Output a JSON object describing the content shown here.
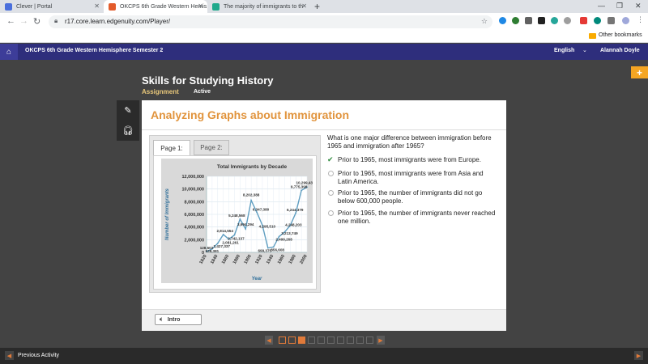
{
  "browser": {
    "tabs": [
      {
        "title": "Clever | Portal",
        "favicon_color": "#4a6fdc"
      },
      {
        "title": "OKCPS 6th Grade Western Hemis",
        "favicon_color": "#e35b2b"
      },
      {
        "title": "The majority of immigrants to th",
        "favicon_color": "#1fa98c"
      }
    ],
    "url": "r17.core.learn.edgenuity.com/Player/",
    "bookmarks_label": "Other bookmarks"
  },
  "app": {
    "course": "OKCPS 6th Grade Western Hemisphere Semester 2",
    "language": "English",
    "user": "Alannah Doyle",
    "accent": "#2e2e7c"
  },
  "lesson": {
    "title": "Skills for Studying History",
    "assignment": "Assignment",
    "status": "Active"
  },
  "card": {
    "title": "Analyzing Graphs about Immigration",
    "tabs": [
      "Page 1:",
      "Page 2:"
    ],
    "question": "What is one major difference between immigration before 1965 and immigration after 1965?",
    "options": [
      {
        "text": "Prior to 1965, most immigrants were from Europe.",
        "selected": true
      },
      {
        "text": "Prior to 1965, most immigrants were from Asia and Latin America.",
        "selected": false
      },
      {
        "text": "Prior to 1965, the number of immigrants did not go below 600,000 people.",
        "selected": false
      },
      {
        "text": "Prior to 1965, the number of immigrants never reached one million.",
        "selected": false
      }
    ],
    "intro_label": "Intro"
  },
  "footer": {
    "prev_label": "Previous Activity"
  },
  "chart_data": {
    "type": "line",
    "title": "Total Immigrants by Decade",
    "xlabel": "Year",
    "ylabel": "Number of Immigrants",
    "x": [
      "1820",
      "1830",
      "1840",
      "1850",
      "1860",
      "1870",
      "1880",
      "1890",
      "1900",
      "1910",
      "1920",
      "1930",
      "1940",
      "1950",
      "1960",
      "1970",
      "1980",
      "1990",
      "2000"
    ],
    "xticks": [
      "1820",
      "1840",
      "1860",
      "1880",
      "1900",
      "1920",
      "1940",
      "1960",
      "1980",
      "2000"
    ],
    "values": [
      128502,
      538381,
      1427337,
      2814554,
      2081261,
      2742137,
      5248568,
      3694294,
      8202388,
      6347380,
      4295510,
      699375,
      856608,
      2499268,
      3213749,
      4248203,
      6244379,
      9775398,
      10299430
    ],
    "labels": [
      "128,502",
      "538,381",
      "1,427,337",
      "2,814,554",
      "2,081,261",
      "2,742,137",
      "5,248,568",
      "3,694,294",
      "8,202,388",
      "6,347,380",
      "4,295,510",
      "699,375",
      "856,608",
      "2,499,268",
      "3,213,749",
      "4,248,203",
      "6,244,379",
      "9,775,398",
      "10,299,430"
    ],
    "yticks": [
      0,
      2000000,
      4000000,
      6000000,
      8000000,
      10000000,
      12000000
    ],
    "yticklabels": [
      "0",
      "2,000,000",
      "4,000,000",
      "6,000,000",
      "8,000,000",
      "10,000,000",
      "12,000,000"
    ],
    "ylim": [
      0,
      12000000
    ],
    "grid": true,
    "line_color": "#5f9ec1"
  }
}
